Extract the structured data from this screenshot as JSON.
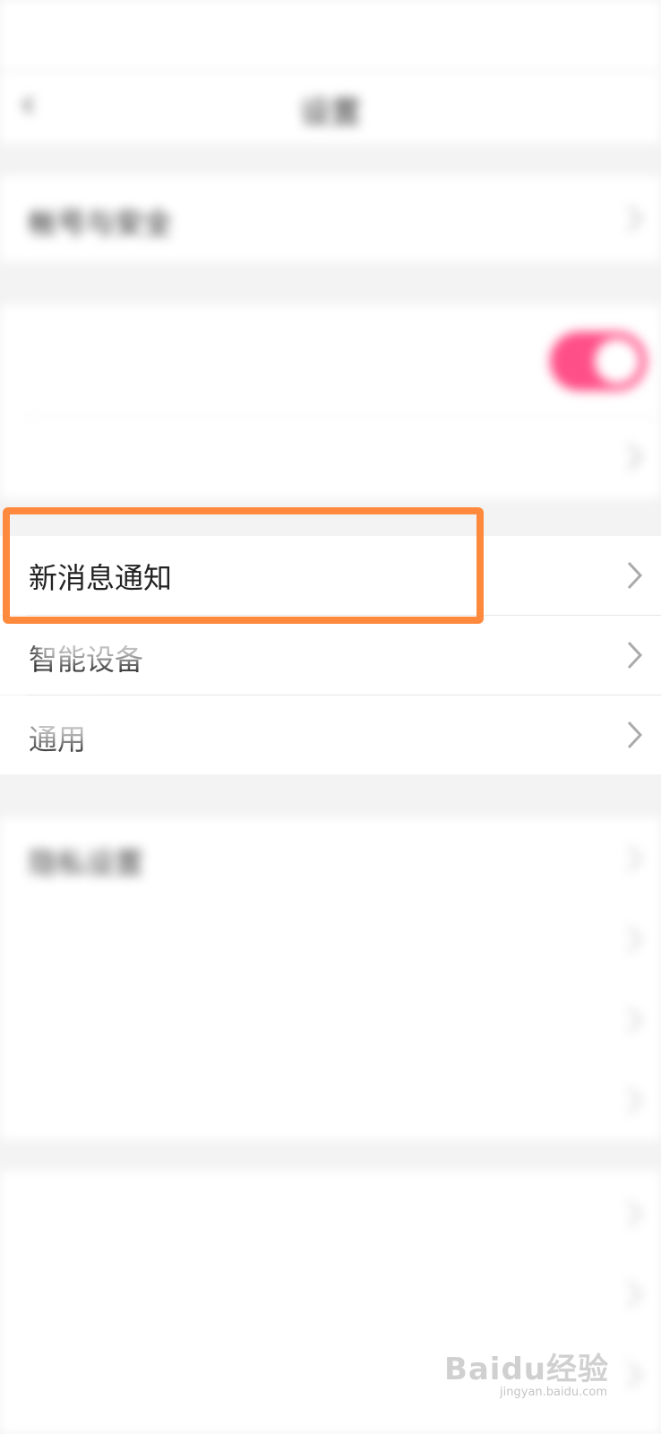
{
  "status_bar": {
    "time": "",
    "indicators": ""
  },
  "header": {
    "back_icon": "chevron-left-icon",
    "title": "设置"
  },
  "groups": {
    "account": {
      "item": "帐号与安全",
      "value": ""
    },
    "toggle_section": {
      "item": "",
      "subtitle": "",
      "toggle_on": true,
      "toggle_color": "#ff4f88",
      "item2": ""
    },
    "main": {
      "new_message_notification": "新消息通知",
      "smart_device": "智能设备",
      "general": "通用"
    },
    "privacy": {
      "privacy_settings": "隐私设置",
      "item2": "",
      "item3": "",
      "item4": ""
    },
    "help": {
      "item1": "",
      "item2": "",
      "item3": ""
    }
  },
  "highlight_color": "#ff8a3d",
  "watermark": {
    "brand": "Baidu经验",
    "url": "jingyan.baidu.com"
  }
}
